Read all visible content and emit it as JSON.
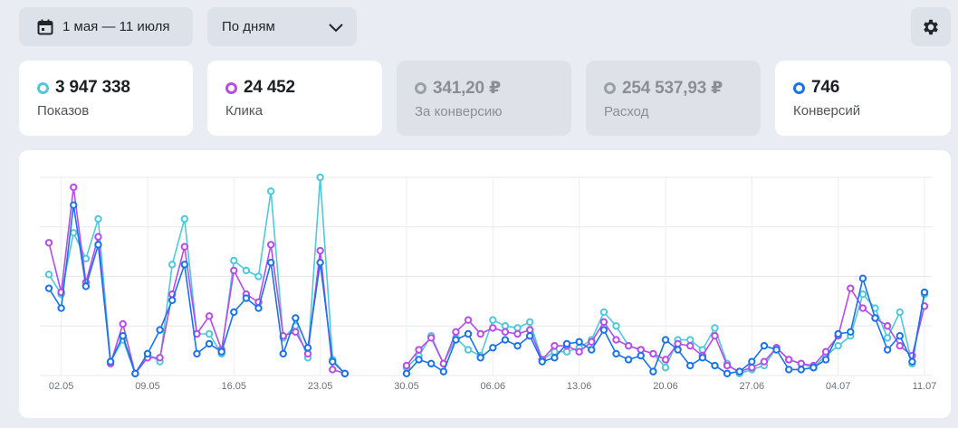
{
  "toolbar": {
    "date_range": "1 мая — 11 июля",
    "grouping": "По дням"
  },
  "metrics": [
    {
      "value": "3 947 338",
      "label": "Показов",
      "color": "#4fc9da",
      "active": true
    },
    {
      "value": "24 452",
      "label": "Клика",
      "color": "#b74ce8",
      "active": true
    },
    {
      "value": "341,20 ₽",
      "label": "За конверсию",
      "color": "#9aa0a8",
      "active": false
    },
    {
      "value": "254 537,93 ₽",
      "label": "Расход",
      "color": "#9aa0a8",
      "active": false
    },
    {
      "value": "746",
      "label": "Конверсий",
      "color": "#1a73e8",
      "active": true
    }
  ],
  "chart_data": {
    "type": "line",
    "x_ticks": [
      "02.05",
      "09.05",
      "16.05",
      "23.05",
      "30.05",
      "06.06",
      "13.06",
      "20.06",
      "27.06",
      "04.07",
      "11.07"
    ],
    "grid": true,
    "ylim": [
      0,
      100
    ],
    "x": [
      "01.05",
      "02.05",
      "03.05",
      "04.05",
      "05.05",
      "06.05",
      "07.05",
      "08.05",
      "09.05",
      "10.05",
      "11.05",
      "12.05",
      "13.05",
      "14.05",
      "15.05",
      "16.05",
      "17.05",
      "18.05",
      "19.05",
      "20.05",
      "21.05",
      "22.05",
      "23.05",
      "24.05",
      "25.05",
      "26.05",
      "27.05",
      "28.05",
      "29.05",
      "30.05",
      "31.05",
      "01.06",
      "02.06",
      "03.06",
      "04.06",
      "05.06",
      "06.06",
      "07.06",
      "08.06",
      "09.06",
      "10.06",
      "11.06",
      "12.06",
      "13.06",
      "14.06",
      "15.06",
      "16.06",
      "17.06",
      "18.06",
      "19.06",
      "20.06",
      "21.06",
      "22.06",
      "23.06",
      "24.06",
      "25.06",
      "26.06",
      "27.06",
      "28.06",
      "29.06",
      "30.06",
      "01.07",
      "02.07",
      "03.07",
      "04.07",
      "05.07",
      "06.07",
      "07.07",
      "08.07",
      "09.07",
      "10.07",
      "11.07"
    ],
    "series": [
      {
        "color": "#4fc9da",
        "values": [
          51,
          41,
          72,
          59,
          79,
          7,
          18,
          1,
          11,
          7,
          56,
          79,
          21,
          21,
          11,
          58,
          53,
          50,
          93,
          19,
          25,
          9,
          100,
          8,
          1,
          null,
          null,
          null,
          null,
          4,
          10,
          20,
          6,
          19,
          13,
          10,
          28,
          25,
          24,
          27,
          8,
          12,
          12,
          14,
          18,
          32,
          25,
          15,
          13,
          11,
          4,
          18,
          18,
          13,
          24,
          6,
          1,
          3,
          5,
          14,
          8,
          6,
          4,
          10,
          15,
          20,
          41,
          34,
          19,
          32,
          6,
          41
        ],
        "line": false
      },
      {
        "color": "#b74ce8",
        "values": [
          67,
          42,
          95,
          47,
          70,
          6,
          26,
          1,
          9,
          9,
          41,
          65,
          21,
          30,
          13,
          53,
          41,
          37,
          66,
          20,
          22,
          11,
          63,
          3,
          1,
          null,
          null,
          null,
          null,
          5,
          13,
          19,
          6,
          22,
          28,
          21,
          24,
          22,
          21,
          23,
          8,
          15,
          15,
          12,
          17,
          27,
          18,
          15,
          13,
          11,
          8,
          16,
          15,
          10,
          20,
          5,
          2,
          4,
          7,
          14,
          8,
          6,
          5,
          12,
          20,
          44,
          34,
          29,
          25,
          15,
          10,
          35
        ],
        "line": false
      },
      {
        "color": "#1a73e8",
        "values": [
          44,
          34,
          86,
          45,
          66,
          7,
          20,
          1,
          11,
          23,
          38,
          56,
          11,
          16,
          12,
          32,
          39,
          34,
          57,
          11,
          29,
          14,
          57,
          7,
          1,
          null,
          null,
          null,
          null,
          1,
          8,
          6,
          2,
          18,
          21,
          9,
          14,
          18,
          15,
          20,
          7,
          9,
          16,
          17,
          13,
          23,
          11,
          8,
          10,
          2,
          18,
          13,
          5,
          9,
          5,
          1,
          2,
          7,
          15,
          13,
          3,
          3,
          4,
          8,
          21,
          22,
          49,
          29,
          13,
          20,
          7,
          42
        ]
      }
    ]
  }
}
